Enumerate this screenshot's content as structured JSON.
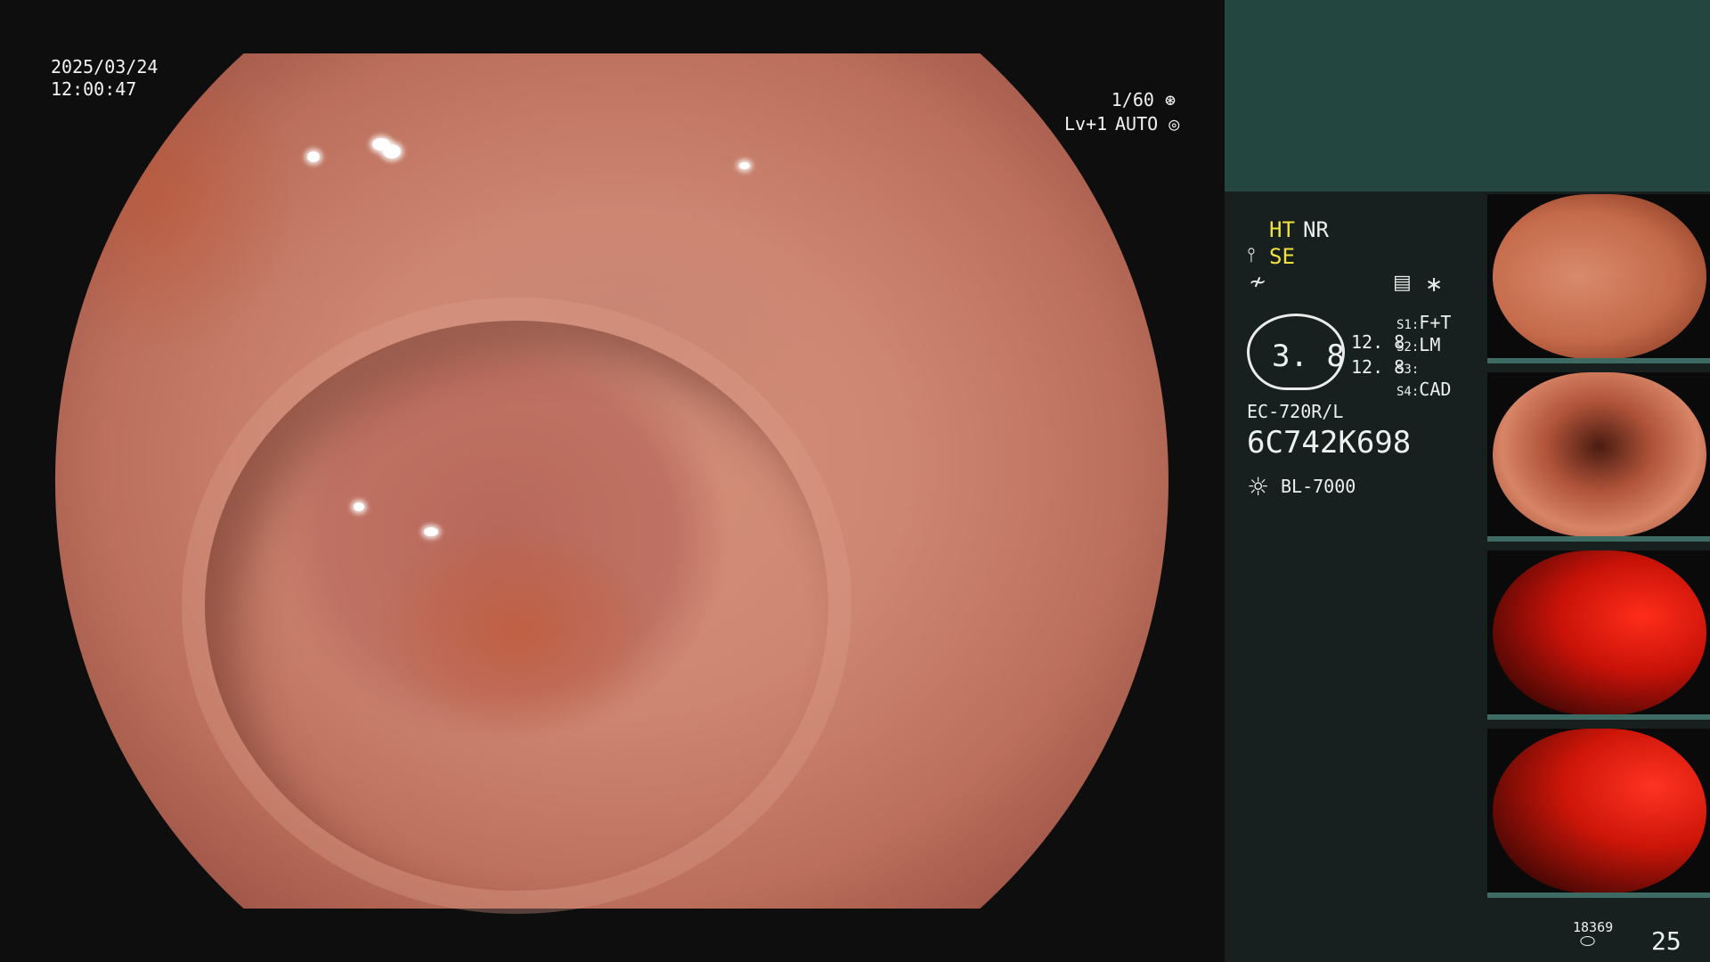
{
  "video": {
    "date": "2025/03/24",
    "time": "12:00:47",
    "shutter": "1/60",
    "level": "Lv+1",
    "iris": "AUTO"
  },
  "panel": {
    "mode_ht": "HT",
    "mode_nr": "NR",
    "mode_se": "SE",
    "zoom_value": "3. 8",
    "zoom_scale_1": "12. 8",
    "zoom_scale_2": "12. 8",
    "switch_labels": [
      "S1:",
      "S2:",
      "S3:",
      "S4:"
    ],
    "switch_values": [
      "F+T",
      "LM",
      "",
      "CAD"
    ],
    "scope_model": "EC-720R/L",
    "serial_number": "6C742K698",
    "light_source": "BL-7000",
    "storage_count": "18369",
    "frame_count": "25"
  },
  "colors": {
    "panel_bg": "#17201e",
    "panel_top": "#234640",
    "highlight_yellow": "#f1e23f"
  },
  "icons": {
    "shutter": "shutter-wheel-icon",
    "iris": "iris-icon",
    "scope_mode": "scope-mode-icon",
    "structure": "structure-enhance-icon",
    "menu": "menu-list-icon",
    "asterisk": "asterisk-icon",
    "light": "light-source-icon",
    "storage": "storage-disk-icon"
  }
}
